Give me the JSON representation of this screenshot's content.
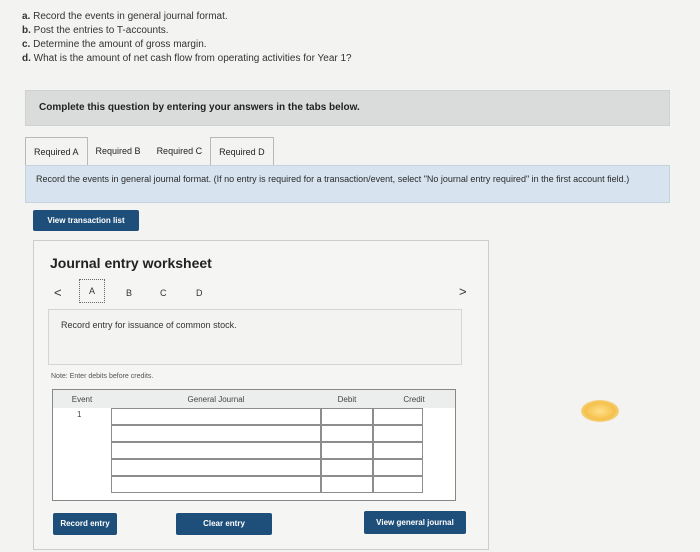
{
  "questions": [
    {
      "letter": "a.",
      "text": "Record the events in general journal format."
    },
    {
      "letter": "b.",
      "text": "Post the entries to T-accounts."
    },
    {
      "letter": "c.",
      "text": "Determine the amount of gross margin."
    },
    {
      "letter": "d.",
      "text": "What is the amount of net cash flow from operating activities for Year 1?"
    }
  ],
  "complete_bar": "Complete this question by entering your answers in the tabs below.",
  "tabs": [
    "Required A",
    "Required B",
    "Required C",
    "Required D"
  ],
  "instruction": "Record the events in general journal format. (If no entry is required for a transaction/event, select \"No journal entry required\" in the first account field.)",
  "view_transaction_list": "View transaction list",
  "worksheet": {
    "title": "Journal entry worksheet",
    "prev": "<",
    "next": ">",
    "tabs": [
      "A",
      "B",
      "C",
      "D"
    ],
    "entry_text": "Record entry for issuance of common stock.",
    "note": "Note: Enter debits before credits.",
    "columns": {
      "event": "Event",
      "general_journal": "General Journal",
      "debit": "Debit",
      "credit": "Credit"
    },
    "event_value": "1",
    "record_entry": "Record entry",
    "clear_entry": "Clear entry",
    "view_general_journal": "View general journal"
  },
  "colors": {
    "primary_button": "#1e4f7a",
    "instruction_bg": "#d7e4ef",
    "highlight": "#f5c04a"
  }
}
